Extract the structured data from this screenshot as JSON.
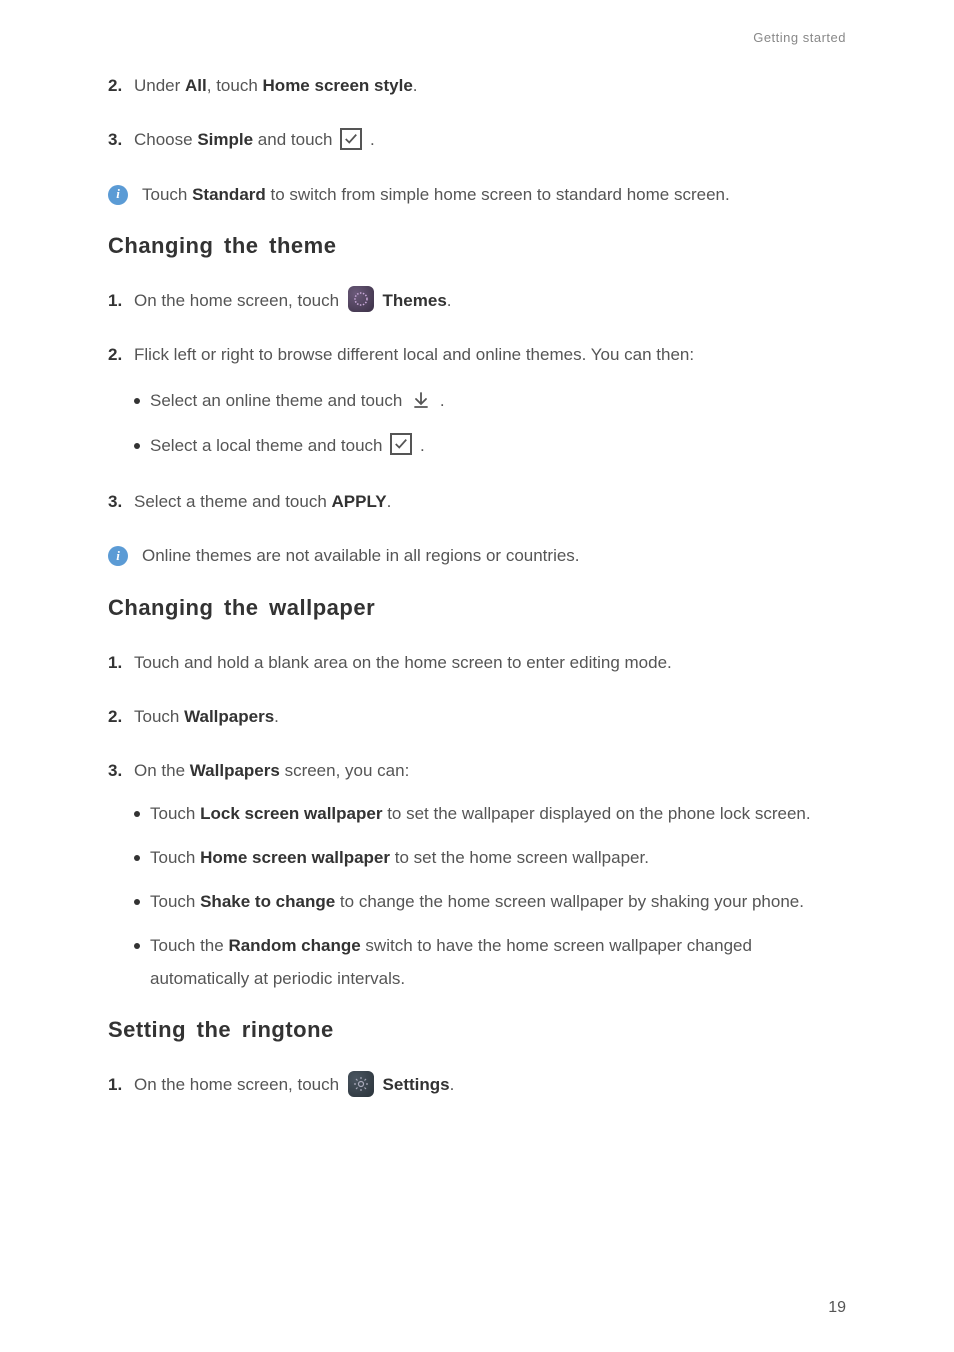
{
  "header": {
    "section": "Getting started"
  },
  "step2": {
    "num": "2.",
    "pre": "Under ",
    "bold1": "All",
    "mid": ", touch ",
    "bold2": "Home screen style",
    "post": "."
  },
  "step3": {
    "num": "3.",
    "pre": "Choose ",
    "bold1": "Simple",
    "mid": " and touch ",
    "post": " ."
  },
  "info1": {
    "pre": "Touch ",
    "bold1": "Standard",
    "post": " to switch from simple home screen to standard home screen."
  },
  "h_theme": "Changing the theme",
  "theme1": {
    "num": "1.",
    "pre": "On the home screen, touch ",
    "bold1": "Themes",
    "post": "."
  },
  "theme2": {
    "num": "2.",
    "text": "Flick left or right to browse different local and online themes. You can then:"
  },
  "theme2a": {
    "pre": "Select an online theme and touch ",
    "post": " ."
  },
  "theme2b": {
    "pre": "Select a local theme and touch ",
    "post": " ."
  },
  "theme3": {
    "num": "3.",
    "pre": "Select a theme and touch ",
    "bold1": "APPLY",
    "post": "."
  },
  "info2": "Online themes are not available in all regions or countries.",
  "h_wall": "Changing the wallpaper",
  "wall1": {
    "num": "1.",
    "text": "Touch and hold a blank area on the home screen to enter editing mode."
  },
  "wall2": {
    "num": "2.",
    "pre": "Touch ",
    "bold1": "Wallpapers",
    "post": "."
  },
  "wall3": {
    "num": "3.",
    "pre": "On the ",
    "bold1": "Wallpapers",
    "post": " screen, you can:"
  },
  "wall3a": {
    "pre": "Touch ",
    "bold1": "Lock screen wallpaper",
    "post": " to set the wallpaper displayed on the phone lock screen."
  },
  "wall3b": {
    "pre": "Touch ",
    "bold1": "Home screen wallpaper",
    "post": " to set the home screen wallpaper."
  },
  "wall3c": {
    "pre": "Touch ",
    "bold1": "Shake to change",
    "post": " to change the home screen wallpaper by shaking your phone."
  },
  "wall3d": {
    "pre": "Touch the ",
    "bold1": "Random change",
    "post": " switch to have the home screen wallpaper changed automatically at periodic intervals."
  },
  "h_ring": "Setting the ringtone",
  "ring1": {
    "num": "1.",
    "pre": "On the home screen, touch ",
    "bold1": "Settings",
    "post": "."
  },
  "page_num": "19"
}
